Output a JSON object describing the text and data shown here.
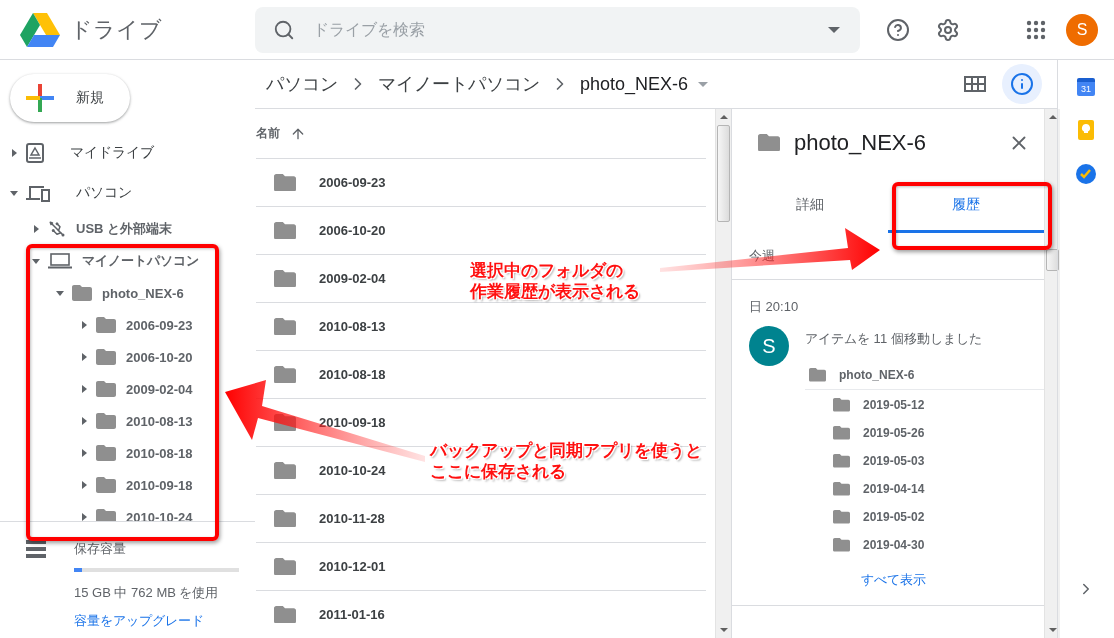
{
  "app": {
    "title": "ドライブ"
  },
  "search": {
    "placeholder": "ドライブを検索"
  },
  "account": {
    "initial": "S"
  },
  "new_button": {
    "label": "新規"
  },
  "sidebar": {
    "tree": [
      {
        "label": "マイドライブ",
        "kind": "drive",
        "expanded": false
      },
      {
        "label": "パソコン",
        "kind": "computers",
        "expanded": true,
        "children": [
          {
            "label": "USB と外部端末",
            "kind": "usb",
            "expanded": false
          },
          {
            "label": "マイノートパソコン",
            "kind": "laptop",
            "expanded": true,
            "children": [
              {
                "label": "photo_NEX-6",
                "kind": "folder",
                "expanded": true,
                "children": [
                  {
                    "label": "2006-09-23",
                    "kind": "folder",
                    "expanded": false
                  },
                  {
                    "label": "2006-10-20",
                    "kind": "folder",
                    "expanded": false
                  },
                  {
                    "label": "2009-02-04",
                    "kind": "folder",
                    "expanded": false
                  },
                  {
                    "label": "2010-08-13",
                    "kind": "folder",
                    "expanded": false
                  },
                  {
                    "label": "2010-08-18",
                    "kind": "folder",
                    "expanded": false
                  },
                  {
                    "label": "2010-09-18",
                    "kind": "folder",
                    "expanded": false
                  },
                  {
                    "label": "2010-10-24",
                    "kind": "folder",
                    "expanded": false
                  }
                ]
              }
            ]
          }
        ]
      }
    ],
    "storage": {
      "title": "保存容量",
      "level": 0.05,
      "usage": "15 GB 中 762 MB を使用",
      "upgrade": "容量をアップグレード"
    }
  },
  "breadcrumb": [
    "パソコン",
    "マイノートパソコン",
    "photo_NEX-6"
  ],
  "file_list": {
    "sort_column": "名前",
    "rows": [
      "2006-09-23",
      "2006-10-20",
      "2009-02-04",
      "2010-08-13",
      "2010-08-18",
      "2010-09-18",
      "2010-10-24",
      "2010-11-28",
      "2010-12-01",
      "2011-01-16"
    ]
  },
  "details": {
    "title": "photo_NEX-6",
    "tabs": [
      {
        "label": "詳細",
        "selected": false
      },
      {
        "label": "履歴",
        "selected": true
      }
    ],
    "section": "今週",
    "time": "日 20:10",
    "activity": {
      "avatar": "S",
      "text": "アイテムを 11 個移動しました",
      "folder": "photo_NEX-6",
      "items": [
        "2019-05-12",
        "2019-05-26",
        "2019-05-03",
        "2019-04-14",
        "2019-05-02",
        "2019-04-30"
      ],
      "show_all": "すべて表示"
    }
  },
  "side_rail": {
    "calendar_day": "31"
  },
  "annotations": [
    {
      "lines": [
        "選択中のフォルダの",
        "作業履歴が表示される"
      ]
    },
    {
      "lines": [
        "バックアップと同期アプリを使うと",
        "ここに保存される"
      ]
    }
  ]
}
